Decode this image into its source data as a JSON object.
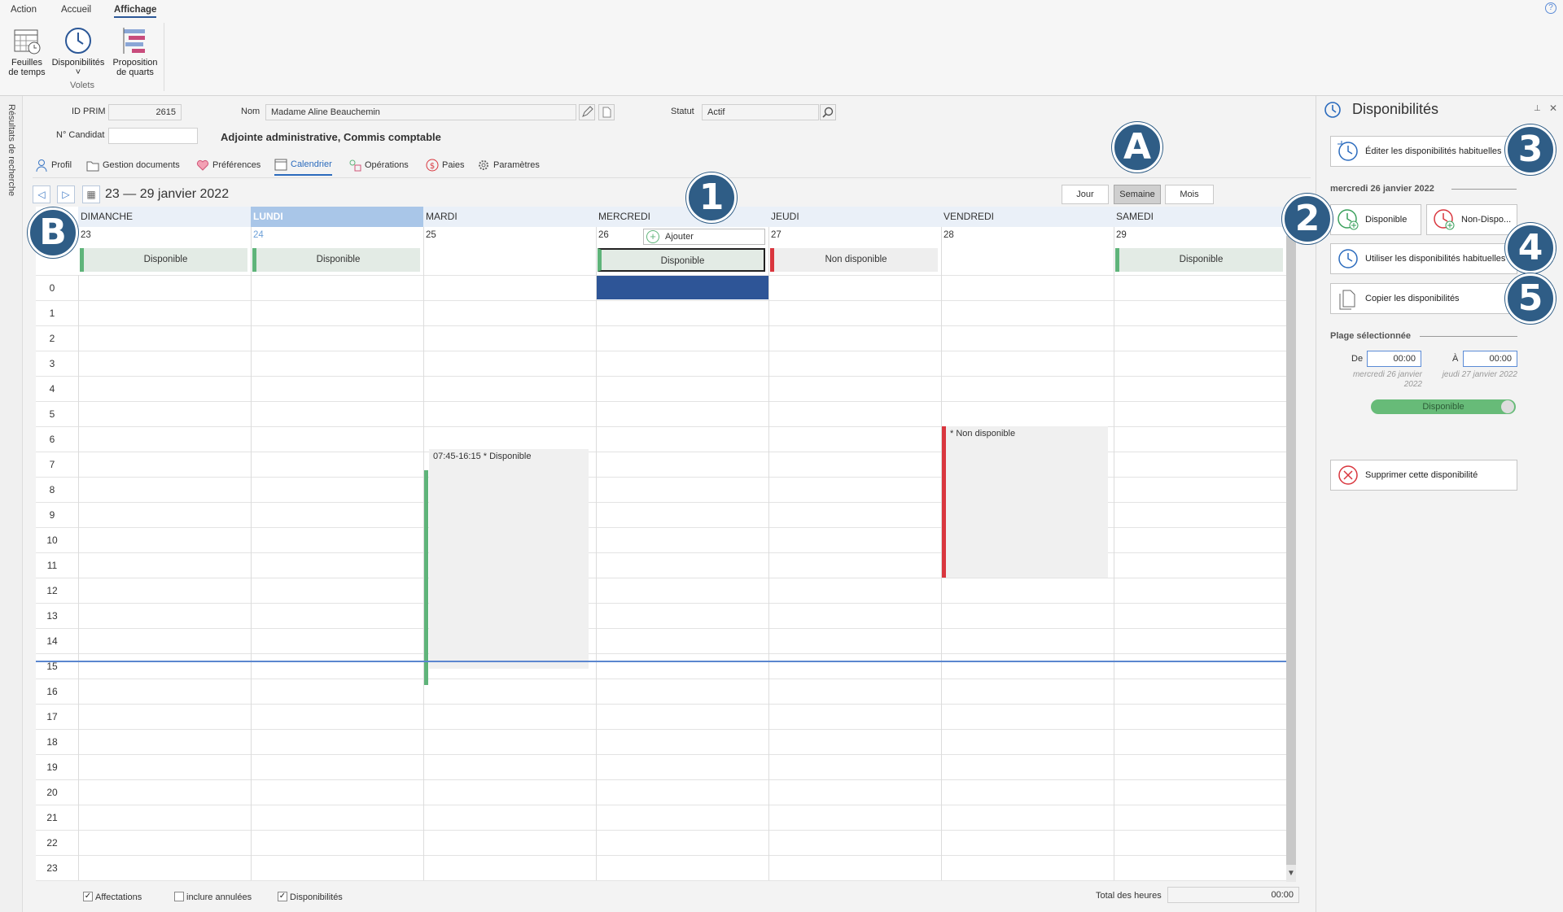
{
  "ribbon": {
    "tabs": [
      "Action",
      "Accueil",
      "Affichage"
    ],
    "buttons": [
      {
        "label1": "Feuilles",
        "label2": "de temps",
        "icon": "timesheet-icon"
      },
      {
        "label1": "Disponibilités",
        "label2": "˅",
        "icon": "clock-icon"
      },
      {
        "label1": "Proposition",
        "label2": "de quarts",
        "icon": "shift-proposal-icon"
      }
    ],
    "group_label": "Volets"
  },
  "strip_label": "Résultats de recherche",
  "employee": {
    "id_label": "ID PRIM",
    "id_value": "2615",
    "name_label": "Nom",
    "name_value": "Madame Aline Beauchemin",
    "status_label": "Statut",
    "status_value": "Actif",
    "candidate_label": "N° Candidat",
    "candidate_value": "",
    "role": "Adjointe administrative, Commis comptable"
  },
  "profile_tabs": [
    "Profil",
    "Gestion documents",
    "Préférences",
    "Calendrier",
    "Opérations",
    "Paies",
    "Paramètres"
  ],
  "calendar": {
    "range": "23 — 29 janvier 2022",
    "views": [
      "Jour",
      "Semaine",
      "Mois"
    ],
    "selected_view": "Semaine",
    "days": [
      {
        "name": "DIMANCHE",
        "num": "23",
        "allday": "Disponible",
        "state": "g"
      },
      {
        "name": "LUNDI",
        "num": "24",
        "allday": "Disponible",
        "state": "g"
      },
      {
        "name": "MARDI",
        "num": "25",
        "allday": "",
        "state": ""
      },
      {
        "name": "MERCREDI",
        "num": "26",
        "allday": "Disponible",
        "state": "g"
      },
      {
        "name": "JEUDI",
        "num": "27",
        "allday": "Non disponible",
        "state": "r"
      },
      {
        "name": "VENDREDI",
        "num": "28",
        "allday": "",
        "state": ""
      },
      {
        "name": "SAMEDI",
        "num": "29",
        "allday": "Disponible",
        "state": "g"
      }
    ],
    "hours": [
      "0",
      "1",
      "2",
      "3",
      "4",
      "5",
      "6",
      "7",
      "8",
      "9",
      "10",
      "11",
      "12",
      "13",
      "14",
      "15",
      "16",
      "17",
      "18",
      "19",
      "20",
      "21",
      "22",
      "23"
    ],
    "add_label": "Ajouter",
    "events": [
      {
        "day": 2,
        "text": "07:45-16:15 * Disponible"
      },
      {
        "day": 5,
        "text": "* Non disponible"
      }
    ]
  },
  "footer": {
    "chk1": "Affectations",
    "chk2": "inclure annulées",
    "chk3": "Disponibilités",
    "total_label": "Total des heures",
    "total_value": "00:00"
  },
  "pane": {
    "title": "Disponibilités",
    "edit_btn": "Éditer les disponibilités habituelles",
    "date_section": "mercredi 26 janvier 2022",
    "dispo_btn": "Disponible",
    "nondispo_btn": "Non-Dispo...",
    "use_btn": "Utiliser les disponibilités habituelles",
    "copy_btn": "Copier les disponibilités",
    "range_section": "Plage sélectionnée",
    "from_label": "De",
    "from_value": "00:00",
    "from_date": "mercredi 26 janvier 2022",
    "to_label": "À",
    "to_value": "00:00",
    "to_date": "jeudi 27 janvier 2022",
    "toggle_label": "Disponible",
    "delete_btn": "Supprimer cette disponibilité"
  },
  "badges": [
    "A",
    "1",
    "B",
    "2",
    "3",
    "4",
    "5"
  ],
  "colors": {
    "accent": "#2b5797",
    "available": "#5fb47a",
    "unavailable": "#d9363e",
    "selection": "#2e5597",
    "badge": "#2f5d86"
  }
}
